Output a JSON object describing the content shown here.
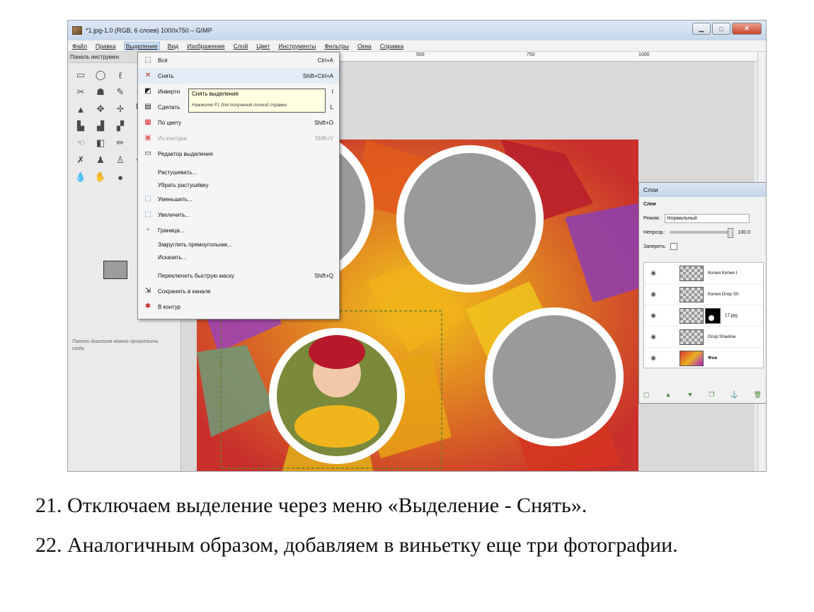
{
  "window": {
    "title": "*1.jpg-1.0 (RGB, 6 слоев) 1000x750 – GIMP",
    "btn_min": "▁",
    "btn_max": "□",
    "btn_close": "✕"
  },
  "menubar": [
    "Файл",
    "Правка",
    "Выделение",
    "Вид",
    "Изображение",
    "Слой",
    "Цвет",
    "Инструменты",
    "Фильтры",
    "Окна",
    "Справка"
  ],
  "toolbox": {
    "title": "Панель инструмен",
    "hint": "Панели диалогов можно прикрепить сюда."
  },
  "ruler": [
    "500",
    "750",
    "1000"
  ],
  "selection_menu": {
    "items": [
      {
        "icon": "⬚",
        "label": "Всё",
        "shortcut": "Ctrl+A",
        "disabled": false
      },
      {
        "icon": "✕",
        "label": "Снять",
        "shortcut": "Shift+Ctrl+A",
        "disabled": false
      },
      {
        "icon": "◩",
        "label": "Инверти",
        "shortcut": "I",
        "disabled": false
      },
      {
        "icon": "▤",
        "label": "Сделать",
        "shortcut": "L",
        "disabled": false
      },
      {
        "icon": "▦",
        "label": "По цвету",
        "shortcut": "Shift+O",
        "disabled": false
      },
      {
        "icon": "▣",
        "label": "Из контура",
        "shortcut": "Shift+V",
        "disabled": true
      },
      {
        "icon": "▭",
        "label": "Редактор выделения",
        "shortcut": "",
        "disabled": false
      },
      {
        "icon": "",
        "label": "Растушевать...",
        "shortcut": "",
        "disabled": false
      },
      {
        "icon": "",
        "label": "Убрать растушёвку",
        "shortcut": "",
        "disabled": false
      },
      {
        "icon": "⬚",
        "label": "Уменьшить...",
        "shortcut": "",
        "disabled": false
      },
      {
        "icon": "⬚",
        "label": "Увеличить...",
        "shortcut": "",
        "disabled": false
      },
      {
        "icon": "▫",
        "label": "Граница...",
        "shortcut": "",
        "disabled": false
      },
      {
        "icon": "",
        "label": "Закруглить прямоугольник...",
        "shortcut": "",
        "disabled": false
      },
      {
        "icon": "",
        "label": "Исказить...",
        "shortcut": "",
        "disabled": false
      },
      {
        "icon": "",
        "label": "Переключить быструю маску",
        "shortcut": "Shift+Q",
        "disabled": false
      },
      {
        "icon": "⇲",
        "label": "Сохранить в канале",
        "shortcut": "",
        "disabled": false
      },
      {
        "icon": "✱",
        "label": "В контур",
        "shortcut": "",
        "disabled": false
      }
    ],
    "tooltip_title": "Снять выделение",
    "tooltip_hint": "Нажмите F1 для получения полной справки"
  },
  "layers_panel": {
    "title": "Слои",
    "tab": "Слои",
    "mode_label": "Режим:",
    "mode_value": "Нормальный",
    "opacity_label": "Непрозр.:",
    "opacity_value": "100.0",
    "lock_label": "Запереть:",
    "layers": [
      {
        "name": "Копия Копия I",
        "thumb": "checker",
        "mask": false,
        "bold": false
      },
      {
        "name": "Копия Drop Sh",
        "thumb": "checker",
        "mask": false,
        "bold": false
      },
      {
        "name": "17.jpg",
        "thumb": "checker",
        "mask": true,
        "bold": false
      },
      {
        "name": "Drop Shadow",
        "thumb": "checker",
        "mask": false,
        "bold": false
      },
      {
        "name": "Фон",
        "thumb": "leaf",
        "mask": false,
        "bold": true
      }
    ]
  },
  "captions": [
    "21. Отключаем выделение через меню «Выделение - Снять».",
    "22. Аналогичным образом, добавляем в виньетку еще три фотографии."
  ]
}
